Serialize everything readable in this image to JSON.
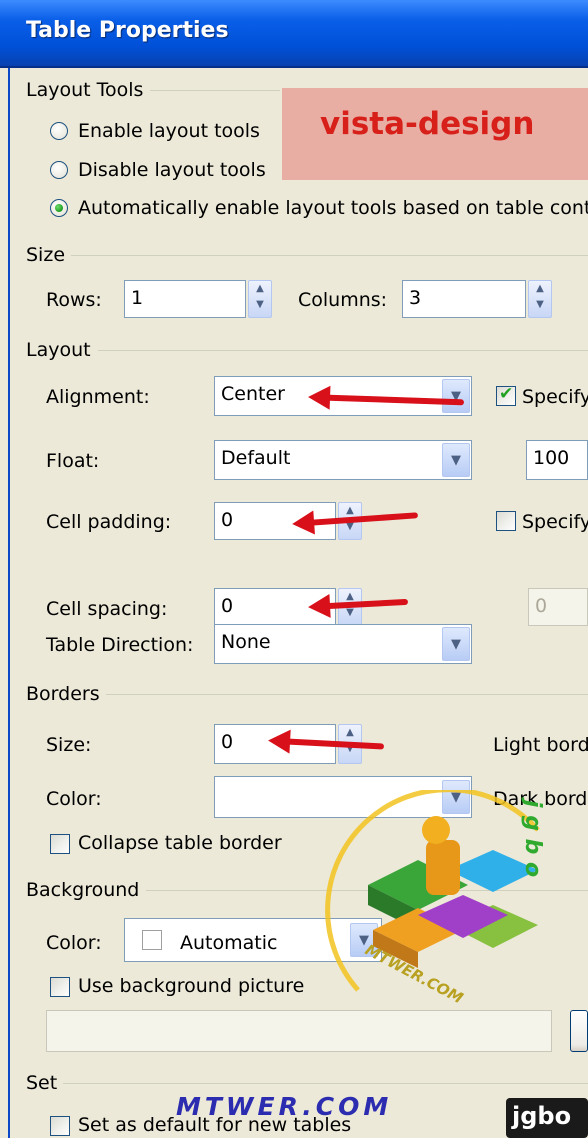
{
  "window": {
    "title": "Table Properties"
  },
  "banner": {
    "text": "vista-design"
  },
  "layout_tools": {
    "group_label": "Layout Tools",
    "options": [
      {
        "label": "Enable layout tools",
        "checked": false
      },
      {
        "label": "Disable layout tools",
        "checked": false
      },
      {
        "label": "Automatically enable layout tools based on table cont",
        "checked": true
      }
    ]
  },
  "size": {
    "group_label": "Size",
    "rows_label": "Rows:",
    "rows_value": "1",
    "columns_label": "Columns:",
    "columns_value": "3"
  },
  "layout": {
    "group_label": "Layout",
    "alignment_label": "Alignment:",
    "alignment_value": "Center",
    "float_label": "Float:",
    "float_value": "Default",
    "cell_padding_label": "Cell padding:",
    "cell_padding_value": "0",
    "cell_spacing_label": "Cell spacing:",
    "cell_spacing_value": "0",
    "direction_label": "Table Direction:",
    "direction_value": "None",
    "specify_width_label": "Specify",
    "specify_width_checked": true,
    "width_value": "100",
    "specify_height_label": "Specify",
    "specify_height_checked": false,
    "height_value": "0"
  },
  "borders": {
    "group_label": "Borders",
    "size_label": "Size:",
    "size_value": "0",
    "color_label": "Color:",
    "color_value": "",
    "light_border_label": "Light bord",
    "dark_border_label": "Dark bord",
    "collapse_label": "Collapse table border",
    "collapse_checked": false
  },
  "background": {
    "group_label": "Background",
    "color_label": "Color:",
    "color_value": "Automatic",
    "use_picture_label": "Use background picture",
    "use_picture_checked": false,
    "picture_path": ""
  },
  "set": {
    "group_label": "Set",
    "default_label": "Set as default for new tables",
    "default_checked": false
  },
  "watermark": {
    "site": "MTWER.COM",
    "ring_text": "MTWER.COM",
    "letters": "j g b o",
    "corner_logo": "jgbo"
  }
}
